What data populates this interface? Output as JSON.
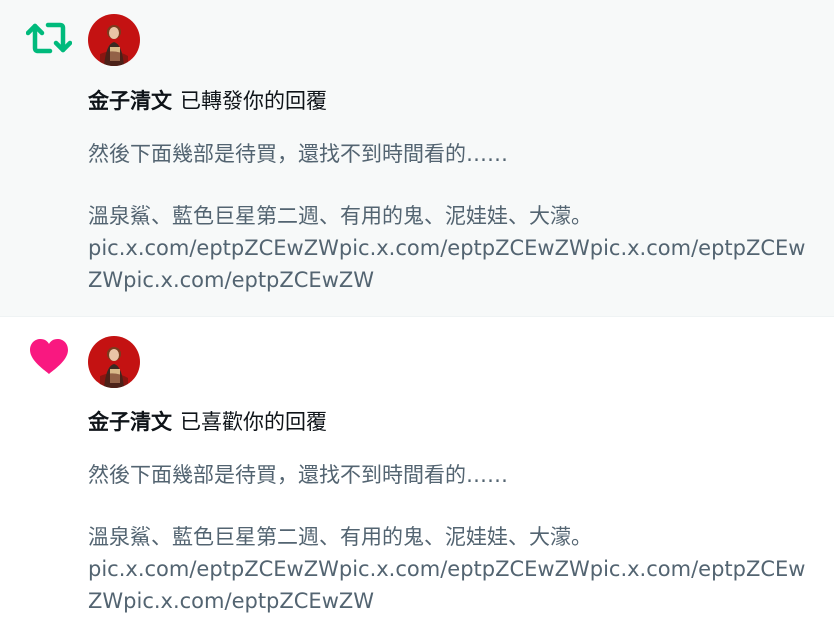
{
  "notifications": [
    {
      "type": "repost",
      "icon": "repost-icon",
      "icon_color": "#00ba7c",
      "actor": "金子清文",
      "action": "已轉發你的回覆",
      "text_line1": "然後下面幾部是待買，還找不到時間看的……",
      "text_line2": "溫泉鯊、藍色巨星第二週、有用的鬼、泥娃娃、大濛。",
      "links": "pic.x.com/eptpZCEwZWpic.x.com/eptpZCEwZWpic.x.com/eptpZCEwZWpic.x.com/eptpZCEwZW"
    },
    {
      "type": "like",
      "icon": "heart-icon",
      "icon_color": "#f91880",
      "actor": "金子清文",
      "action": "已喜歡你的回覆",
      "text_line1": "然後下面幾部是待買，還找不到時間看的……",
      "text_line2": "溫泉鯊、藍色巨星第二週、有用的鬼、泥娃娃、大濛。",
      "links": "pic.x.com/eptpZCEwZWpic.x.com/eptpZCEwZWpic.x.com/eptpZCEwZWpic.x.com/eptpZCEwZW"
    }
  ]
}
